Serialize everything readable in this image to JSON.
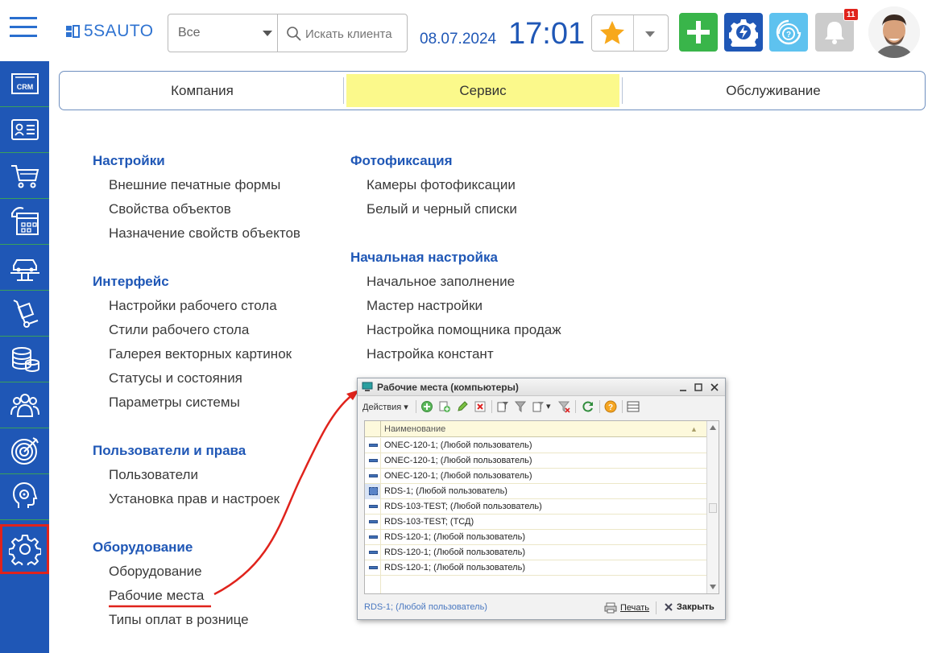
{
  "header": {
    "logo_text": "5SAUTO",
    "filter_value": "Все",
    "search_placeholder": "Искать клиента",
    "date": "08.07.2024",
    "time": "17:01",
    "notifications_count": "11"
  },
  "tabs": [
    {
      "label": "Компания"
    },
    {
      "label": "Сервис"
    },
    {
      "label": "Обслуживание"
    }
  ],
  "menu": {
    "settings": {
      "title": "Настройки",
      "items": [
        "Внешние печатные формы",
        "Свойства объектов",
        "Назначение свойств объектов"
      ]
    },
    "interface": {
      "title": "Интерфейс",
      "items": [
        "Настройки рабочего стола",
        "Стили рабочего стола",
        "Галерея векторных картинок",
        "Статусы и состояния",
        "Параметры системы"
      ]
    },
    "users": {
      "title": "Пользователи и права",
      "items": [
        "Пользователи",
        "Установка прав и настроек"
      ]
    },
    "equipment": {
      "title": "Оборудование",
      "items": [
        "Оборудование",
        "Рабочие места",
        "Типы оплат в рознице"
      ]
    },
    "photo": {
      "title": "Фотофиксация",
      "items": [
        "Камеры фотофиксации",
        "Белый и черный списки"
      ]
    },
    "initial": {
      "title": "Начальная настройка",
      "items": [
        "Начальное заполнение",
        "Мастер настройки",
        "Настройка помощника продаж",
        "Настройка констант"
      ]
    }
  },
  "sidebar": {
    "items": [
      "crm-icon",
      "contacts-icon",
      "cart-icon",
      "calendar-icon",
      "car-lift-icon",
      "cargo-icon",
      "coins-icon",
      "staff-icon",
      "target-icon",
      "support-icon",
      "gear-icon"
    ],
    "crm_label": "CRM",
    "active_index": 10
  },
  "popup": {
    "title": "Рабочие места (компьютеры)",
    "actions_label": "Действия",
    "column_header": "Наименование",
    "rows": [
      "ONEC-120-1; (Любой пользователь)",
      "ONEC-120-1; (Любой пользователь)",
      "ONEC-120-1; (Любой пользователь)",
      "RDS-1; (Любой пользователь)",
      "RDS-103-TEST; (Любой пользователь)",
      "RDS-103-TEST; (ТСД)",
      "RDS-120-1; (Любой пользователь)",
      "RDS-120-1; (Любой пользователь)",
      "RDS-120-1; (Любой пользователь)"
    ],
    "selected_row_index": 3,
    "status": "RDS-1; (Любой пользователь)",
    "print_label": "Печать",
    "close_label": "Закрыть"
  },
  "colors": {
    "brand_blue": "#1f57b6",
    "active_tab": "#fbf98b",
    "add_green": "#39b54a",
    "highlight_red": "#e0231c"
  }
}
